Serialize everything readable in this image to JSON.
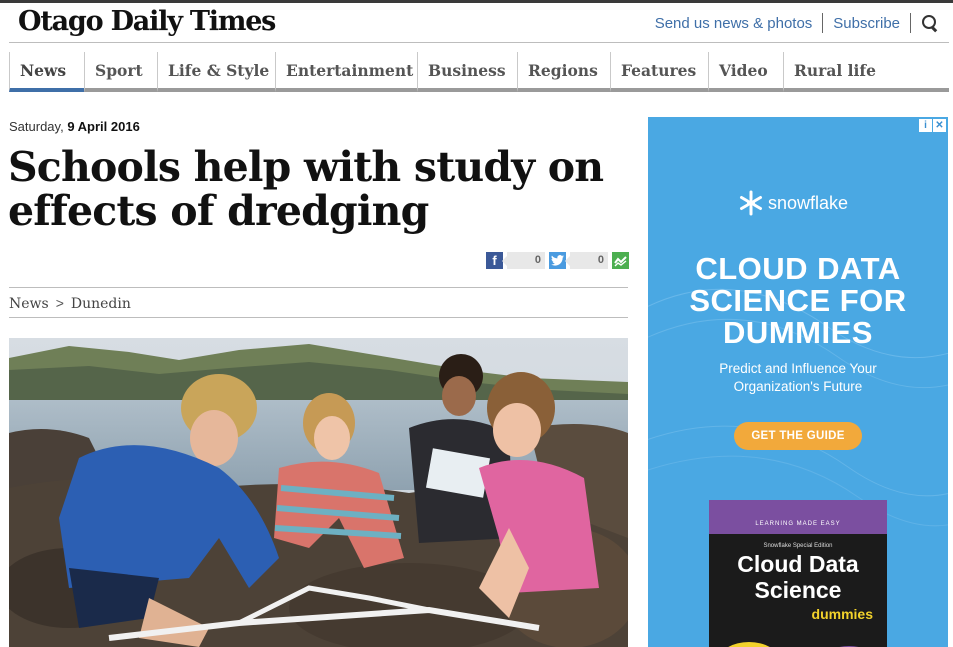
{
  "site": {
    "logo": "Otago Daily Times",
    "util_links": [
      "Send us news & photos",
      "Subscribe"
    ]
  },
  "nav": {
    "items": [
      "News",
      "Sport",
      "Life & Style",
      "Entertainment",
      "Business",
      "Regions",
      "Features",
      "Video",
      "Rural life"
    ],
    "active": "News"
  },
  "article": {
    "day": "Saturday,",
    "date": "9 April 2016",
    "headline": "Schools help with study on effects of dredging",
    "share": {
      "facebook_count": "0",
      "twitter_count": "0"
    },
    "breadcrumb": {
      "section": "News",
      "separator": ">",
      "subsection": "Dunedin"
    }
  },
  "ad": {
    "brand": "snowflake",
    "title": "CLOUD DATA SCIENCE FOR DUMMIES",
    "subtitle": "Predict and Influence Your Organization's Future",
    "cta": "GET THE GUIDE",
    "book": {
      "kicker": "LEARNING MADE EASY",
      "edition": "Snowflake Special Edition",
      "title": "Cloud Data Science",
      "brand": "dummies"
    }
  },
  "colors": {
    "link": "#3f6fa8",
    "ad_bg": "#4aa8e3",
    "cta": "#f2a93b",
    "nav_active": "#3f6fa8"
  }
}
